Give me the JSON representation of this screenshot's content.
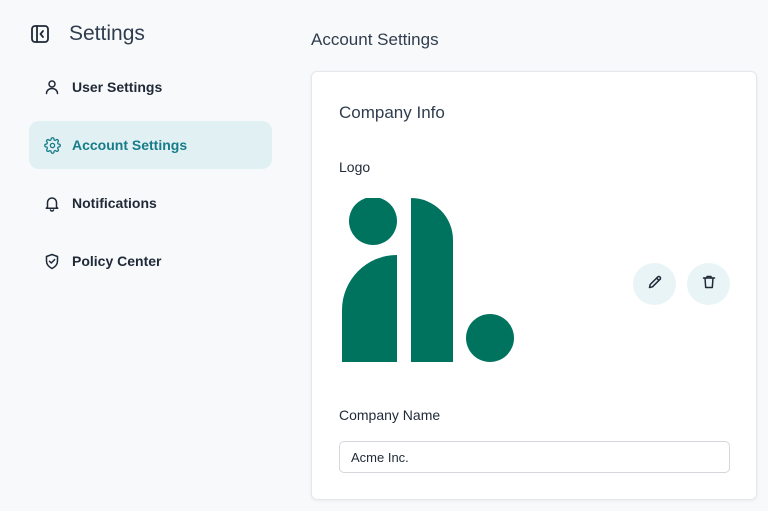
{
  "sidebar": {
    "title": "Settings",
    "collapse_icon": "sidebar-collapse-icon",
    "items": [
      {
        "label": "User Settings",
        "icon": "user-icon",
        "active": false
      },
      {
        "label": "Account Settings",
        "icon": "gear-icon",
        "active": true
      },
      {
        "label": "Notifications",
        "icon": "bell-icon",
        "active": false
      },
      {
        "label": "Policy Center",
        "icon": "shield-check-icon",
        "active": false
      }
    ]
  },
  "main": {
    "title": "Account Settings",
    "card": {
      "title": "Company Info",
      "logo_label": "Logo",
      "edit_icon": "pencil-icon",
      "delete_icon": "trash-icon",
      "company_name_label": "Company Name",
      "company_name_value": "Acme Inc."
    }
  },
  "colors": {
    "accent": "#177c88",
    "active_bg": "#e0f0f3",
    "logo_green": "#00735f",
    "icon_button_bg": "#e8f4f6"
  }
}
